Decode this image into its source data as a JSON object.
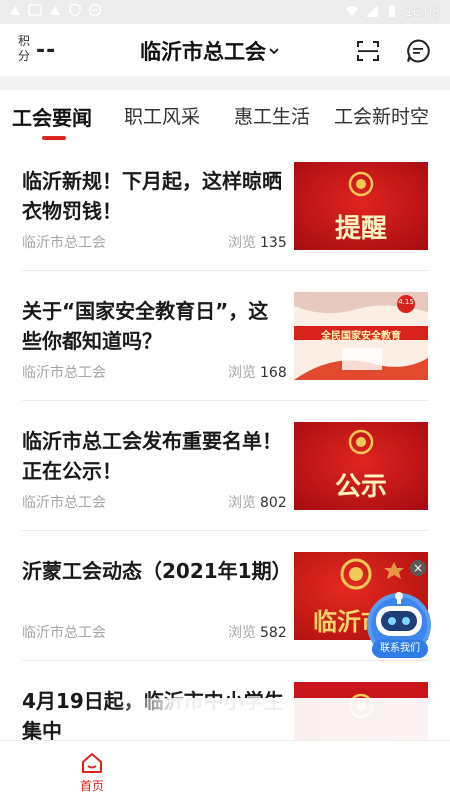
{
  "status_bar": {
    "time": "16:05"
  },
  "header": {
    "points_label": "积分",
    "points_value": "--",
    "title": "临沂市总工会",
    "icons": [
      "scan-icon",
      "message-icon"
    ]
  },
  "tabs": [
    "工会要闻",
    "职工风采",
    "惠工生活",
    "工会新时空"
  ],
  "news": [
    {
      "title": "临沂新规！下月起，这样晾晒衣物罚钱！",
      "source": "临沂市总工会",
      "views_label": "浏览",
      "views": "135",
      "thumb_text": "提醒"
    },
    {
      "title": "关于“国家安全教育日”，这些你都知道吗？",
      "source": "临沂市总工会",
      "views_label": "浏览",
      "views": "168",
      "thumb_text": "全民国家安全教育",
      "thumb_badge": "4.15"
    },
    {
      "title": "临沂市总工会发布重要名单！正在公示！",
      "source": "临沂市总工会",
      "views_label": "浏览",
      "views": "802",
      "thumb_text": "公示"
    },
    {
      "title": "沂蒙工会动态（2021年1期）",
      "source": "临沂市总工会",
      "views_label": "浏览",
      "views": "582",
      "thumb_text": "临沂市总"
    },
    {
      "title": "4月19日起，临沂市中小学生集中",
      "source": "",
      "views_label": "",
      "views": "",
      "thumb_text": ""
    }
  ],
  "robot": {
    "label": "联系我们",
    "close": "×"
  },
  "bottom_nav": {
    "home_label": "首页"
  },
  "colors": {
    "accent": "#d9261c",
    "thumb_red": "#c8141a",
    "robot_blue": "#2f7be8"
  }
}
